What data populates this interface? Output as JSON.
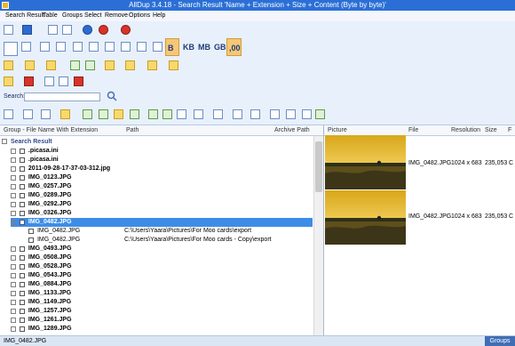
{
  "window": {
    "title": "AllDup 3.4.18 - Search Result 'Name + Extension + Size + Content (Byte by byte)'"
  },
  "menu": {
    "items": [
      "Search Result",
      "Table",
      "Groups",
      "Select",
      "Remove",
      "Options",
      "Help"
    ]
  },
  "toolbar": {
    "unit_labels": [
      "B",
      "KB",
      "MB",
      "GB",
      ",00"
    ],
    "search_label": "Search:",
    "search_value": ""
  },
  "left_table": {
    "headers": [
      "Group - File Name With Extension",
      "Path",
      "Archive Path"
    ],
    "root_label": "Search Result",
    "rows": [
      {
        "name": ".picasa.ini",
        "path": "",
        "type": "group"
      },
      {
        "name": ".picasa.ini",
        "path": "",
        "type": "group"
      },
      {
        "name": "2011-09-28-17-37-03-312.jpg",
        "path": "",
        "type": "group"
      },
      {
        "name": "IMG_0123.JPG",
        "path": "",
        "type": "group"
      },
      {
        "name": "IMG_0257.JPG",
        "path": "",
        "type": "group"
      },
      {
        "name": "IMG_0289.JPG",
        "path": "",
        "type": "group"
      },
      {
        "name": "IMG_0292.JPG",
        "path": "",
        "type": "group"
      },
      {
        "name": "IMG_0326.JPG",
        "path": "",
        "type": "group"
      },
      {
        "name": "IMG_0482.JPG",
        "path": "",
        "type": "group",
        "selected": true
      },
      {
        "name": "IMG_0482.JPG",
        "path": "C:\\Users\\Yaara\\Pictures\\For Moo cards\\export",
        "type": "child"
      },
      {
        "name": "IMG_0482.JPG",
        "path": "C:\\Users\\Yaara\\Pictures\\For Moo cards - Copy\\export",
        "type": "child"
      },
      {
        "name": "IMG_0493.JPG",
        "path": "",
        "type": "group"
      },
      {
        "name": "IMG_0508.JPG",
        "path": "",
        "type": "group"
      },
      {
        "name": "IMG_0528.JPG",
        "path": "",
        "type": "group"
      },
      {
        "name": "IMG_0543.JPG",
        "path": "",
        "type": "group"
      },
      {
        "name": "IMG_0884.JPG",
        "path": "",
        "type": "group"
      },
      {
        "name": "IMG_1133.JPG",
        "path": "",
        "type": "group"
      },
      {
        "name": "IMG_1149.JPG",
        "path": "",
        "type": "group"
      },
      {
        "name": "IMG_1257.JPG",
        "path": "",
        "type": "group"
      },
      {
        "name": "IMG_1261.JPG",
        "path": "",
        "type": "group"
      },
      {
        "name": "IMG_1289.JPG",
        "path": "",
        "type": "group"
      }
    ]
  },
  "right_table": {
    "headers": [
      "Picture",
      "File",
      "Resolution",
      "Size",
      "F"
    ],
    "rows": [
      {
        "file": "IMG_0482.JPG",
        "resolution": "1024 x 683",
        "size": "235,053",
        "f": "C"
      },
      {
        "file": "IMG_0482.JPG",
        "resolution": "1024 x 683",
        "size": "235,053",
        "f": "C"
      }
    ]
  },
  "status": {
    "text": "IMG_0482.JPG",
    "tab": "Groups"
  }
}
